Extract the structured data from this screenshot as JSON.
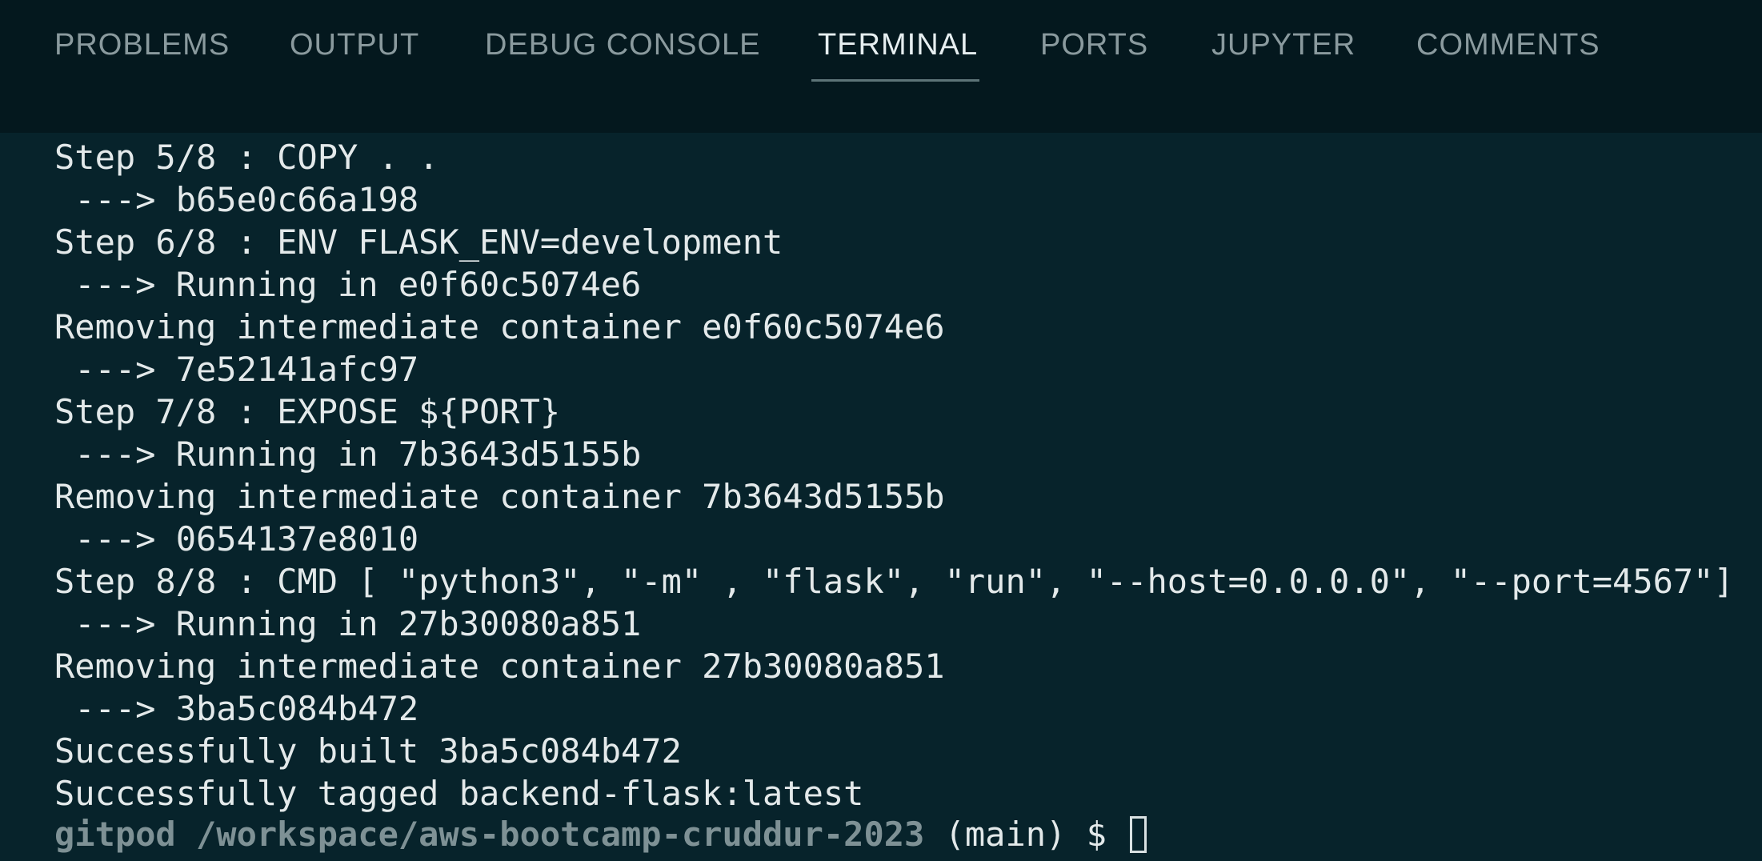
{
  "panel_tabs": [
    {
      "label": "PROBLEMS",
      "active": false
    },
    {
      "label": "OUTPUT",
      "active": false
    },
    {
      "label": "DEBUG CONSOLE",
      "active": false
    },
    {
      "label": "TERMINAL",
      "active": true
    },
    {
      "label": "PORTS",
      "active": false
    },
    {
      "label": "JUPYTER",
      "active": false
    },
    {
      "label": "COMMENTS",
      "active": false
    }
  ],
  "terminal": {
    "lines": [
      "Step 5/8 : COPY . .",
      " ---> b65e0c66a198",
      "Step 6/8 : ENV FLASK_ENV=development",
      " ---> Running in e0f60c5074e6",
      "Removing intermediate container e0f60c5074e6",
      " ---> 7e52141afc97",
      "Step 7/8 : EXPOSE ${PORT}",
      " ---> Running in 7b3643d5155b",
      "Removing intermediate container 7b3643d5155b",
      " ---> 0654137e8010",
      "Step 8/8 : CMD [ \"python3\", \"-m\" , \"flask\", \"run\", \"--host=0.0.0.0\", \"--port=4567\"]",
      " ---> Running in 27b30080a851",
      "Removing intermediate container 27b30080a851",
      " ---> 3ba5c084b472",
      "Successfully built 3ba5c084b472",
      "Successfully tagged backend-flask:latest"
    ],
    "prompt": {
      "user_path": "gitpod /workspace/aws-bootcamp-cruddur-2023",
      "branch": " (main) $ "
    }
  },
  "colors": {
    "panel_background": "#04181e",
    "terminal_background": "#07232b",
    "text": "#e3e9ea",
    "inactive_tab": "#8a9a9e",
    "active_tab": "#e6eef0",
    "prompt_path": "#7e9195"
  }
}
